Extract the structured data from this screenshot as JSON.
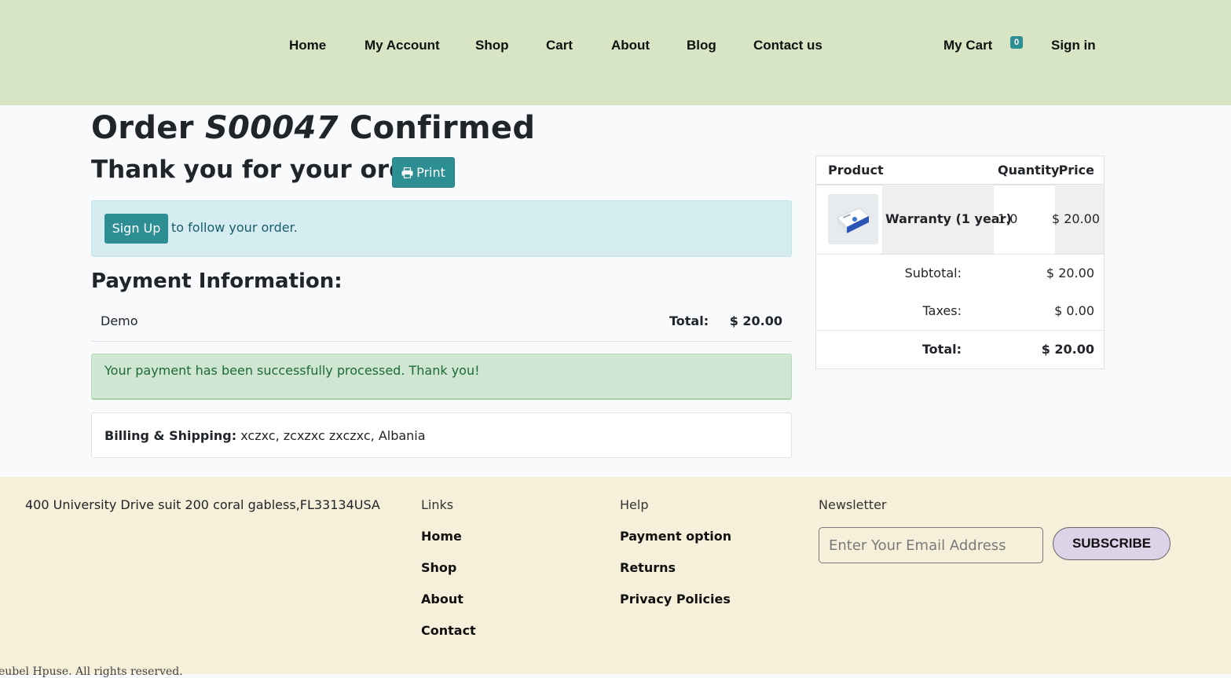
{
  "header": {
    "nav": [
      "Home",
      "My Account",
      "Shop",
      "Cart",
      "About",
      "Blog",
      "Contact us"
    ],
    "cart_label": "My Cart",
    "cart_count": "0",
    "signin_label": "Sign in"
  },
  "order": {
    "title_prefix": "Order",
    "number": "S00047",
    "title_suffix": "Confirmed",
    "thanks": "Thank you for your order.",
    "print_label": "Print",
    "signup_label": "Sign Up",
    "follow_text": "to follow your order."
  },
  "payment": {
    "heading": "Payment Information:",
    "method": "Demo",
    "total_label": "Total:",
    "total_value": "$ 20.00",
    "success_message": "Your payment has been successfully processed. Thank you!"
  },
  "billing": {
    "label": "Billing & Shipping:",
    "address": "xczxc, zcxzxc zxczxc, Albania"
  },
  "summary": {
    "headers": {
      "product": "Product",
      "quantity": "Quantity",
      "price": "Price"
    },
    "line": {
      "product": "Warranty (1 year)",
      "quantity": "1.0",
      "price": "$ 20.00",
      "image_icon": "product-box-icon"
    },
    "subtotal_label": "Subtotal:",
    "subtotal_value": "$ 20.00",
    "taxes_label": "Taxes:",
    "taxes_value": "$ 0.00",
    "total_label": "Total:",
    "total_value": "$ 20.00"
  },
  "footer": {
    "address": "400 University Drive suit 200 coral gabless,FL33134USA",
    "links_title": "Links",
    "links": [
      "Home",
      "Shop",
      "About",
      "Contact"
    ],
    "help_title": "Help",
    "help": [
      "Payment option",
      "Returns",
      "Privacy Policies"
    ],
    "newsletter_title": "Newsletter",
    "email_placeholder": "Enter Your Email Address",
    "subscribe_label": "SUBSCRIBE",
    "copyright": "eubel Hpuse. All rights reserved."
  },
  "colors": {
    "header_bg": "#d7e5c5",
    "accent": "#2d8f94",
    "footer_bg": "#f6f0da",
    "success_bg": "#cfe6d2",
    "info_bg": "#d5ecf0"
  }
}
